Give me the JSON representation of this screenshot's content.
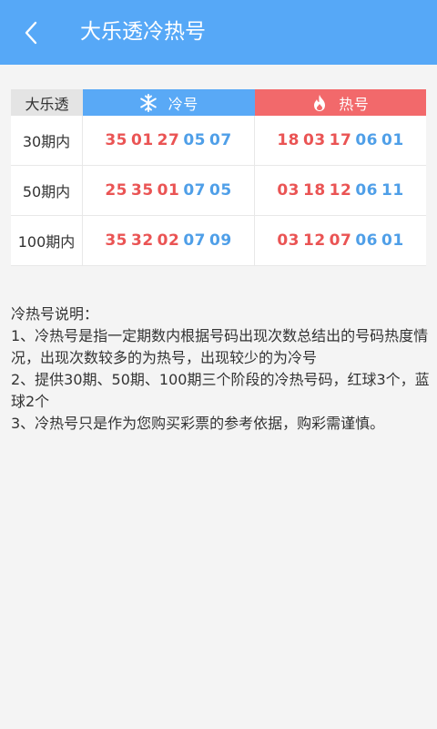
{
  "header": {
    "title": "大乐透冷热号"
  },
  "table": {
    "corner_label": "大乐透",
    "cold_label": "冷号",
    "hot_label": "热号",
    "rows": [
      {
        "period": "30期内",
        "cold_red": [
          "35",
          "01",
          "27"
        ],
        "cold_blue": [
          "05",
          "07"
        ],
        "hot_red": [
          "18",
          "03",
          "17"
        ],
        "hot_blue": [
          "06",
          "01"
        ]
      },
      {
        "period": "50期内",
        "cold_red": [
          "25",
          "35",
          "01"
        ],
        "cold_blue": [
          "07",
          "05"
        ],
        "hot_red": [
          "03",
          "18",
          "12"
        ],
        "hot_blue": [
          "06",
          "11"
        ]
      },
      {
        "period": "100期内",
        "cold_red": [
          "35",
          "32",
          "02"
        ],
        "cold_blue": [
          "07",
          "09"
        ],
        "hot_red": [
          "03",
          "12",
          "07"
        ],
        "hot_blue": [
          "06",
          "01"
        ]
      }
    ]
  },
  "description": {
    "heading": "冷热号说明：",
    "items": [
      " 1、冷热号是指一定期数内根据号码出现次数总结出的号码热度情况，出现次数较多的为热号，出现较少的为冷号",
      " 2、提供30期、50期、100期三个阶段的冷热号码，红球3个，蓝球2个",
      " 3、冷热号只是作为您购买彩票的参考依据，购彩需谨慎。"
    ]
  },
  "colors": {
    "header_bg": "#56a8f7",
    "cold_bg": "#59a9f6",
    "hot_bg": "#f2696b",
    "red_ball": "#ea5454",
    "blue_ball": "#4f9fe8"
  },
  "icons": {
    "back": "chevron-left-icon",
    "cold": "snowflake-icon",
    "hot": "flame-icon"
  }
}
